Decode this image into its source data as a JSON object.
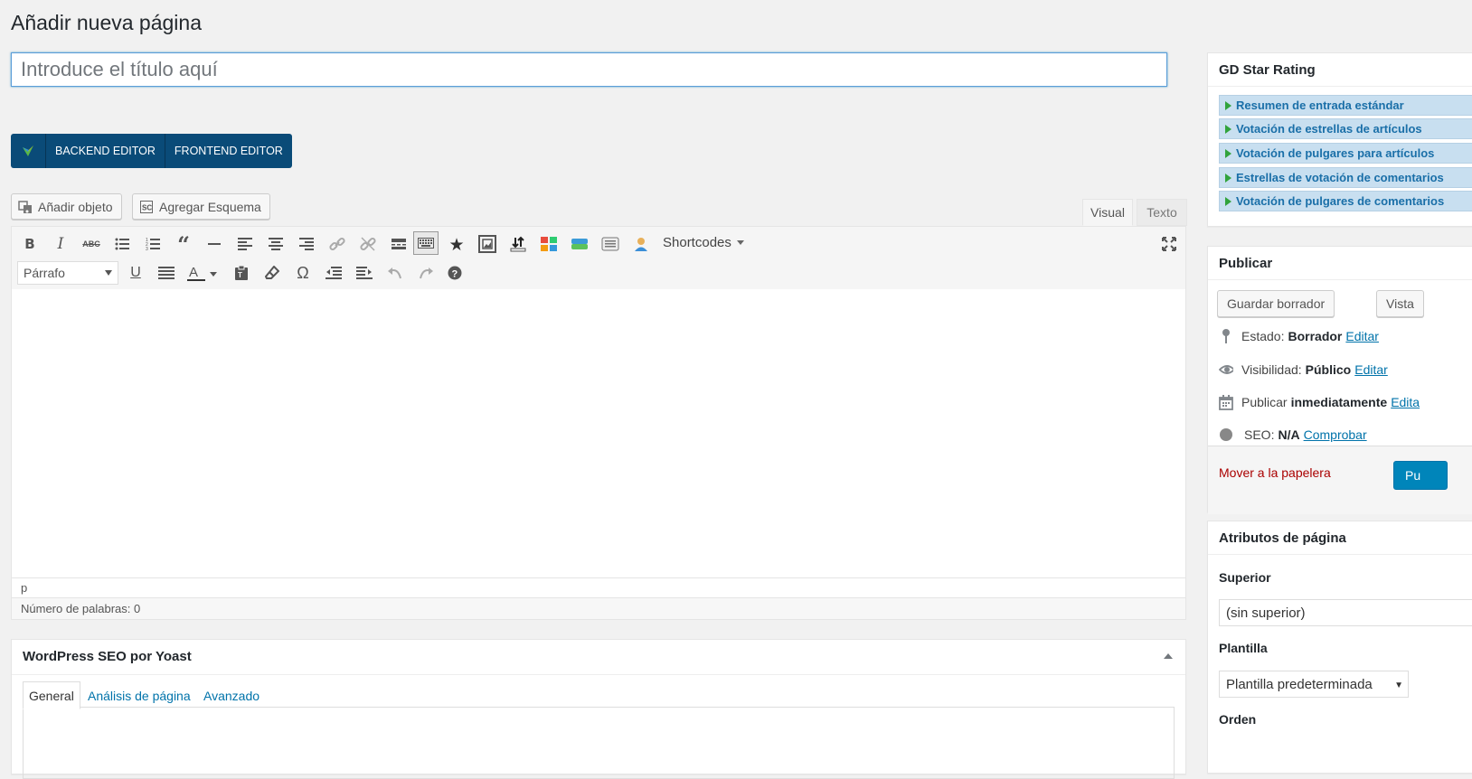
{
  "page": {
    "title": "Añadir nueva página",
    "title_placeholder": "Introduce el título aquí"
  },
  "vc": {
    "backend": "BACKEND EDITOR",
    "frontend": "FRONTEND EDITOR"
  },
  "media": {
    "add_object": "Añadir objeto",
    "add_schema": "Agregar Esquema"
  },
  "editor": {
    "tab_visual": "Visual",
    "tab_text": "Texto",
    "format": "Párrafo",
    "shortcodes": "Shortcodes",
    "path": "p",
    "word_count": "Número de palabras: 0"
  },
  "yoast": {
    "title": "WordPress SEO por Yoast",
    "tabs": [
      "General",
      "Análisis de página",
      "Avanzado"
    ]
  },
  "gd_star": {
    "title": "GD Star Rating",
    "items": [
      "Resumen de entrada estándar",
      "Votación de estrellas de artículos",
      "Votación de pulgares para artículos",
      "Estrellas de votación de comentarios",
      "Votación de pulgares de comentarios"
    ]
  },
  "publish": {
    "title": "Publicar",
    "save_draft": "Guardar borrador",
    "preview": "Vista",
    "status_label": "Estado:",
    "status_value": "Borrador",
    "visibility_label": "Visibilidad:",
    "visibility_value": "Público",
    "publish_label": "Publicar",
    "publish_value": "inmediatamente",
    "seo_label": "SEO:",
    "seo_value": "N/A",
    "seo_check": "Comprobar",
    "edit": "Editar",
    "edit_cut": "Edita",
    "trash": "Mover a la papelera",
    "publish_btn": "Pu"
  },
  "attributes": {
    "title": "Atributos de página",
    "parent_label": "Superior",
    "parent_value": "(sin superior)",
    "template_label": "Plantilla",
    "template_value": "Plantilla predeterminada",
    "order_label": "Orden"
  },
  "colors": {
    "accent": "#0073aa",
    "vc_bar": "#0a4b78",
    "publish": "#0085ba",
    "trash": "#a00000"
  }
}
